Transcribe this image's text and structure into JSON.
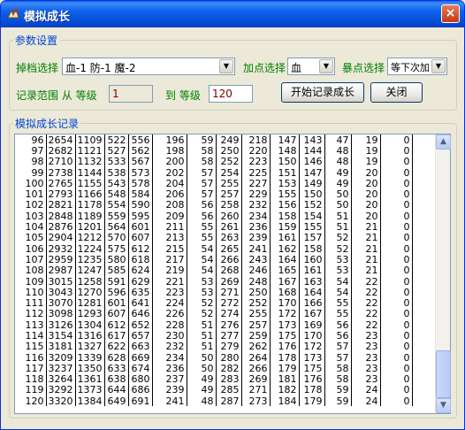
{
  "window": {
    "title": "模拟成长",
    "close_glyph": "×"
  },
  "params": {
    "legend": "参数设置",
    "drop_label": "掉档选择",
    "drop_value": "血-1 防-1 魔-2",
    "point_label": "加点选择",
    "point_value": "血",
    "crit_label": "暴点选择",
    "crit_value": "等下次加",
    "range_label": "记录范围 从 等级",
    "from_level": "1",
    "to_label": "到 等级",
    "to_level": "120",
    "start_button": "开始记录成长",
    "close_button": "关闭"
  },
  "records": {
    "legend": "模拟成长记录",
    "rows": [
      [
        "96",
        "2654",
        "1109",
        "522",
        "556",
        "196",
        "59",
        "249",
        "218",
        "147",
        "143",
        "47",
        "19",
        "0"
      ],
      [
        "97",
        "2682",
        "1121",
        "527",
        "562",
        "198",
        "58",
        "250",
        "220",
        "148",
        "144",
        "48",
        "19",
        "0"
      ],
      [
        "98",
        "2710",
        "1132",
        "533",
        "567",
        "200",
        "58",
        "252",
        "223",
        "150",
        "146",
        "48",
        "19",
        "0"
      ],
      [
        "99",
        "2738",
        "1144",
        "538",
        "573",
        "202",
        "57",
        "254",
        "225",
        "151",
        "147",
        "49",
        "20",
        "0"
      ],
      [
        "100",
        "2765",
        "1155",
        "543",
        "578",
        "204",
        "57",
        "255",
        "227",
        "153",
        "149",
        "49",
        "20",
        "0"
      ],
      [
        "101",
        "2793",
        "1166",
        "548",
        "584",
        "206",
        "57",
        "257",
        "229",
        "155",
        "150",
        "50",
        "20",
        "0"
      ],
      [
        "102",
        "2821",
        "1178",
        "554",
        "590",
        "208",
        "56",
        "258",
        "232",
        "156",
        "152",
        "50",
        "20",
        "0"
      ],
      [
        "103",
        "2848",
        "1189",
        "559",
        "595",
        "209",
        "56",
        "260",
        "234",
        "158",
        "154",
        "51",
        "20",
        "0"
      ],
      [
        "104",
        "2876",
        "1201",
        "564",
        "601",
        "211",
        "55",
        "261",
        "236",
        "159",
        "155",
        "51",
        "21",
        "0"
      ],
      [
        "105",
        "2904",
        "1212",
        "570",
        "607",
        "213",
        "55",
        "263",
        "239",
        "161",
        "157",
        "52",
        "21",
        "0"
      ],
      [
        "106",
        "2932",
        "1224",
        "575",
        "612",
        "215",
        "54",
        "265",
        "241",
        "162",
        "158",
        "52",
        "21",
        "0"
      ],
      [
        "107",
        "2959",
        "1235",
        "580",
        "618",
        "217",
        "54",
        "266",
        "243",
        "164",
        "160",
        "53",
        "21",
        "0"
      ],
      [
        "108",
        "2987",
        "1247",
        "585",
        "624",
        "219",
        "54",
        "268",
        "246",
        "165",
        "161",
        "53",
        "21",
        "0"
      ],
      [
        "109",
        "3015",
        "1258",
        "591",
        "629",
        "221",
        "53",
        "269",
        "248",
        "167",
        "163",
        "54",
        "22",
        "0"
      ],
      [
        "110",
        "3043",
        "1270",
        "596",
        "635",
        "223",
        "53",
        "271",
        "250",
        "168",
        "164",
        "54",
        "22",
        "0"
      ],
      [
        "111",
        "3070",
        "1281",
        "601",
        "641",
        "224",
        "52",
        "272",
        "252",
        "170",
        "166",
        "55",
        "22",
        "0"
      ],
      [
        "112",
        "3098",
        "1293",
        "607",
        "646",
        "226",
        "52",
        "274",
        "255",
        "172",
        "167",
        "55",
        "22",
        "0"
      ],
      [
        "113",
        "3126",
        "1304",
        "612",
        "652",
        "228",
        "51",
        "276",
        "257",
        "173",
        "169",
        "56",
        "22",
        "0"
      ],
      [
        "114",
        "3154",
        "1316",
        "617",
        "657",
        "230",
        "51",
        "277",
        "259",
        "175",
        "170",
        "56",
        "23",
        "0"
      ],
      [
        "115",
        "3181",
        "1327",
        "622",
        "663",
        "232",
        "51",
        "279",
        "262",
        "176",
        "172",
        "57",
        "23",
        "0"
      ],
      [
        "116",
        "3209",
        "1339",
        "628",
        "669",
        "234",
        "50",
        "280",
        "264",
        "178",
        "173",
        "57",
        "23",
        "0"
      ],
      [
        "117",
        "3237",
        "1350",
        "633",
        "674",
        "236",
        "50",
        "282",
        "266",
        "179",
        "175",
        "58",
        "23",
        "0"
      ],
      [
        "118",
        "3264",
        "1361",
        "638",
        "680",
        "237",
        "49",
        "283",
        "269",
        "181",
        "176",
        "58",
        "23",
        "0"
      ],
      [
        "119",
        "3292",
        "1373",
        "644",
        "686",
        "239",
        "49",
        "285",
        "271",
        "182",
        "178",
        "59",
        "24",
        "0"
      ],
      [
        "120",
        "3320",
        "1384",
        "649",
        "691",
        "241",
        "48",
        "287",
        "273",
        "184",
        "179",
        "59",
        "24",
        "0"
      ]
    ]
  },
  "icons": {
    "scroll_up": "▲",
    "scroll_down": "▼",
    "dropdown": "▼"
  }
}
